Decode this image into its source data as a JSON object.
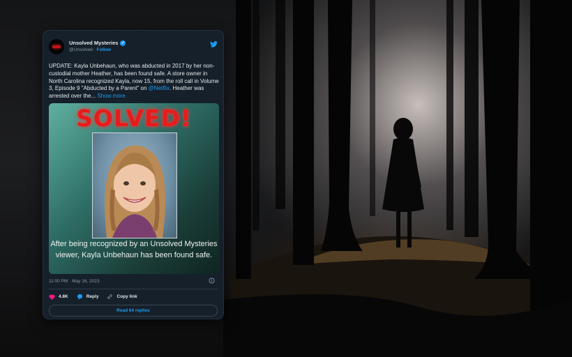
{
  "tweet": {
    "account_name": "Unsolved Mysteries",
    "handle": "@Unsolved",
    "separator": " · ",
    "follow_label": "Follow",
    "text_part1": "UPDATE: Kayla Unbehaun, who was abducted in 2017 by her non-custodial mother Heather, has been found safe. A store owner in North Carolina recognized Kayla, now 15, from the roll call in Volume 3, Episode 9 \"Abducted by a Parent\" on ",
    "mention": "@Netflix",
    "text_part2": ". Heather was arrested over the... ",
    "show_more": "Show more",
    "media": {
      "headline": "SOLVED!",
      "caption": "After being recognized by an Unsolved Mysteries viewer, Kayla Unbehaun has been found safe."
    },
    "timestamp": "11:00 PM · May 16, 2023",
    "likes_count": "4.8K",
    "reply_label": "Reply",
    "copy_link_label": "Copy link",
    "read_replies_label": "Read 64 replies"
  },
  "colors": {
    "card_bg": "#15202b",
    "accent_blue": "#1d9bf0",
    "like_pink": "#f91880",
    "solved_red": "#e61c1c"
  },
  "icons": [
    "bird-icon",
    "verified-badge-icon",
    "info-icon",
    "heart-icon",
    "reply-bubble-icon",
    "link-icon"
  ]
}
